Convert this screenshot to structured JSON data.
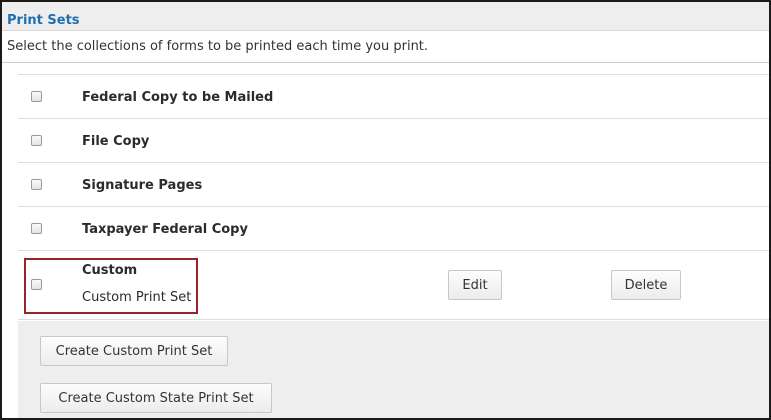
{
  "header": {
    "title": "Print Sets"
  },
  "instructions": "Select the collections of forms to be printed each time you print.",
  "print_sets": [
    {
      "label": "Federal Copy to be Mailed",
      "checked": false
    },
    {
      "label": "File Copy",
      "checked": false
    },
    {
      "label": "Signature Pages",
      "checked": false
    },
    {
      "label": "Taxpayer Federal Copy",
      "checked": false
    }
  ],
  "custom": {
    "title": "Custom",
    "name": "Custom Print Set",
    "checked": false,
    "edit_label": "Edit",
    "delete_label": "Delete",
    "highlight_color": "#9b2226"
  },
  "actions": {
    "create_label": "Create Custom Print Set",
    "create_state_label": "Create Custom State Print Set"
  },
  "colors": {
    "accent": "#1f6fb2",
    "header_bg": "#eeeeee"
  }
}
